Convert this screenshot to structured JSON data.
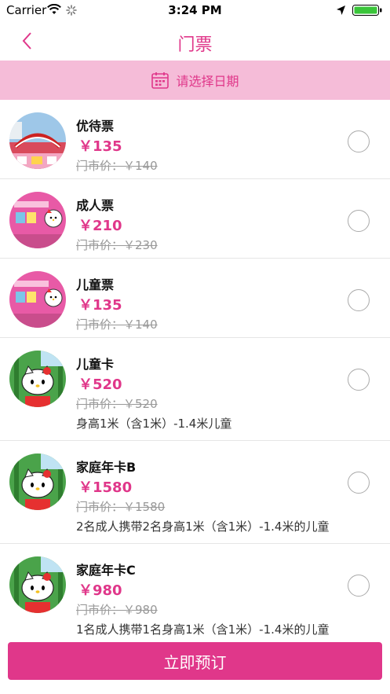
{
  "status_bar": {
    "carrier": "Carrier",
    "time": "3:24 PM",
    "icons": [
      "wifi-icon",
      "activity-spinner-icon",
      "location-arrow-icon",
      "battery-icon"
    ]
  },
  "nav": {
    "title": "门票",
    "back_icon": "chevron-left-icon"
  },
  "date_picker": {
    "label": "请选择日期",
    "icon": "calendar-icon"
  },
  "colors": {
    "accent": "#e0378a",
    "date_bar_bg": "#f5bcd8"
  },
  "tickets": [
    {
      "name": "优待票",
      "price": "￥135",
      "original_price": "门市价：￥140",
      "image": "amusement-park-photo"
    },
    {
      "name": "成人票",
      "price": "￥210",
      "original_price": "门市价：￥230",
      "image": "hello-kitty-ticket"
    },
    {
      "name": "儿童票",
      "price": "￥135",
      "original_price": "门市价：￥140",
      "image": "hello-kitty-ticket"
    },
    {
      "name": "儿童卡",
      "price": "￥520",
      "original_price": "门市价：￥520",
      "description": "身高1米（含1米）-1.4米儿童",
      "image": "hello-kitty-card"
    },
    {
      "name": "家庭年卡B",
      "price": "￥1580",
      "original_price": "门市价：￥1580",
      "description": "2名成人携带2名身高1米（含1米）-1.4米的儿童",
      "image": "hello-kitty-card"
    },
    {
      "name": "家庭年卡C",
      "price": "￥980",
      "original_price": "门市价：￥980",
      "description": "1名成人携带1名身高1米（含1米）-1.4米的儿童",
      "image": "hello-kitty-card"
    }
  ],
  "footer": {
    "book_label": "立即预订"
  }
}
